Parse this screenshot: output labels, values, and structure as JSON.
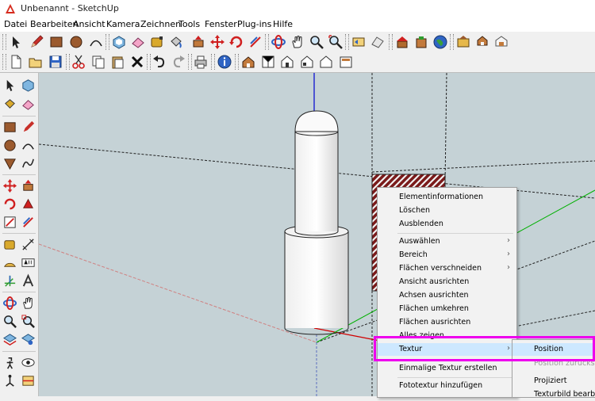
{
  "window": {
    "title": "Unbenannt - SketchUp"
  },
  "menubar": {
    "items": [
      "Datei",
      "Bearbeiten",
      "Ansicht",
      "Kamera",
      "Zeichnen",
      "Tools",
      "Fenster",
      "Plug-ins",
      "Hilfe"
    ]
  },
  "toolbar_icons_row1": [
    "select-arrow-icon",
    "pencil-icon",
    "rectangle-icon",
    "circle-icon",
    "arc-icon",
    "eraser-icon",
    "tape-measure-icon",
    "paint-bucket-icon",
    "push-pull-icon",
    "move-icon",
    "rotate-icon",
    "offset-icon",
    "orbit-icon",
    "pan-icon",
    "zoom-icon",
    "zoom-extents-icon",
    "previous-view-icon",
    "next-view-icon",
    "add-location-icon",
    "google-earth-icon",
    "get-models-icon",
    "share-model-icon",
    "components-icon"
  ],
  "toolbar_icons_row2": [
    "new-icon",
    "open-icon",
    "save-icon",
    "cut-icon",
    "copy-icon",
    "paste-icon",
    "delete-icon",
    "undo-icon",
    "redo-icon",
    "print-icon",
    "model-info-icon",
    "iso-view-icon",
    "top-view-icon",
    "front-view-icon",
    "right-view-icon",
    "back-view-icon",
    "left-view-icon"
  ],
  "context_menu": {
    "items": [
      {
        "label": "Elementinformationen",
        "submenu": false
      },
      {
        "label": "Löschen",
        "submenu": false
      },
      {
        "label": "Ausblenden",
        "submenu": false
      },
      {
        "label": "Auswählen",
        "submenu": true
      },
      {
        "label": "Bereich",
        "submenu": true
      },
      {
        "label": "Flächen verschneiden",
        "submenu": true
      },
      {
        "label": "Ansicht ausrichten",
        "submenu": false
      },
      {
        "label": "Achsen ausrichten",
        "submenu": false
      },
      {
        "label": "Flächen umkehren",
        "submenu": false
      },
      {
        "label": "Flächen ausrichten",
        "submenu": false
      },
      {
        "label": "Alles zeigen",
        "submenu": false
      },
      {
        "label": "Textur",
        "submenu": true
      },
      {
        "label": "Einmalige Textur erstellen",
        "submenu": false
      },
      {
        "label": "Fototextur hinzufügen",
        "submenu": false
      }
    ],
    "arrow": "›"
  },
  "texture_submenu": {
    "items": [
      "Position",
      "Position zurücksetzen",
      "Projiziert",
      "Texturbild bearbeiten"
    ]
  },
  "colors": {
    "viewport_bg": "#c5d2d6",
    "highlight": "#ee00ee",
    "menu_hover": "#cde8ff",
    "axis_red": "#d00000",
    "axis_green": "#00b000",
    "axis_blue": "#0000d0"
  }
}
